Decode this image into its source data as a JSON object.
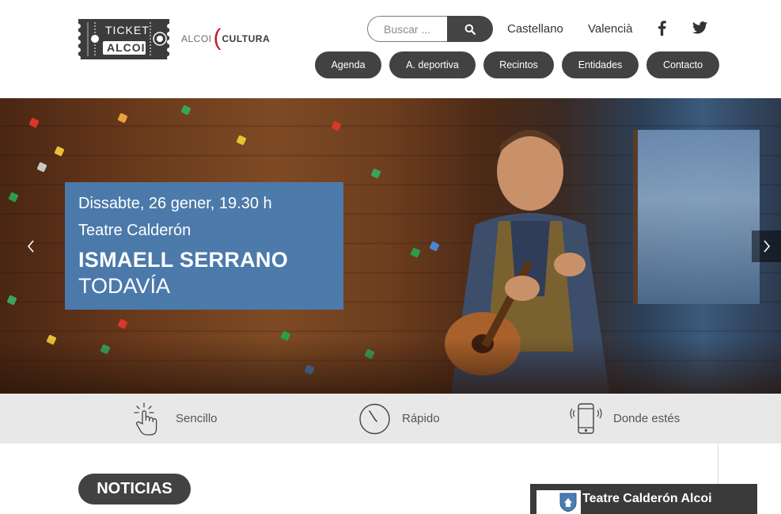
{
  "header": {
    "logo_ticket_text": [
      "TICKET",
      "ALCOI"
    ],
    "logo_cultura": {
      "alcoi": "ALCOI",
      "paren": "(",
      "cultura": "CULTURA"
    },
    "search": {
      "placeholder": "Buscar ...",
      "icon": "search-icon"
    },
    "languages": [
      "Castellano",
      "Valencià"
    ],
    "social": [
      {
        "name": "facebook",
        "icon": "facebook-icon"
      },
      {
        "name": "twitter",
        "icon": "twitter-icon"
      }
    ],
    "nav": [
      "Agenda",
      "A. deportiva",
      "Recintos",
      "Entidades",
      "Contacto"
    ]
  },
  "hero": {
    "banner": {
      "date": "Dissabte, 26 gener, 19.30 h",
      "venue": "Teatre Calderón",
      "artist": "ISMAELL SERRANO",
      "show": "TODAVÍA"
    },
    "prev_icon": "chevron-left-icon",
    "next_icon": "chevron-right-icon"
  },
  "features": [
    {
      "label": "Sencillo",
      "icon": "tap-hand-icon"
    },
    {
      "label": "Rápido",
      "icon": "stopwatch-icon"
    },
    {
      "label": "Donde estés",
      "icon": "mobile-phone-icon"
    }
  ],
  "news": {
    "heading": "NOTICIAS"
  },
  "facebook_widget": {
    "title": "Teatre Calderón Alcoi"
  },
  "colors": {
    "pill": "#424242",
    "banner": "#4a7db2",
    "accent_red": "#c0202f",
    "feature_bar": "#e8e8e8"
  }
}
